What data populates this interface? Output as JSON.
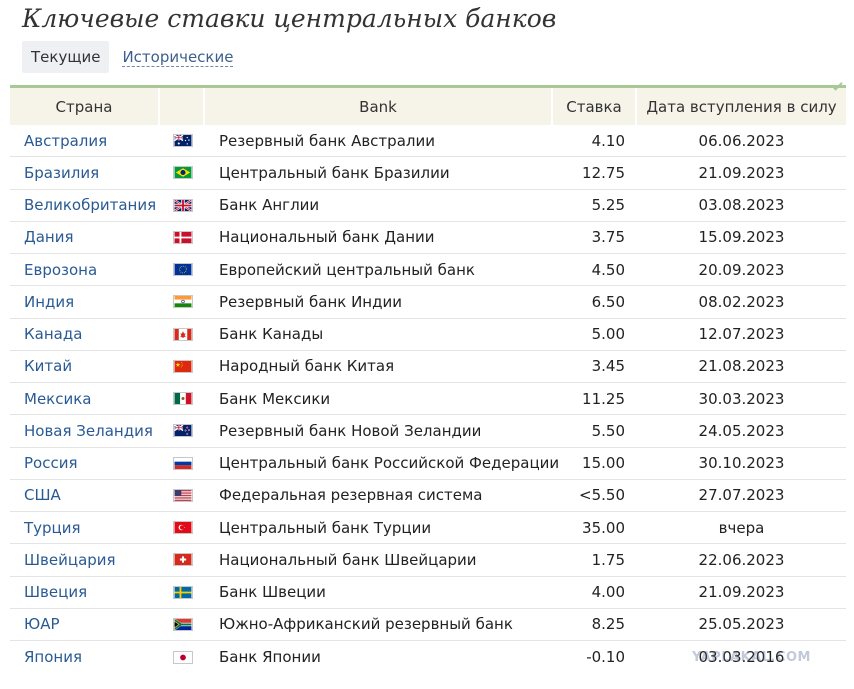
{
  "page": {
    "title": "Ключевые ставки центральных банков"
  },
  "tabs": [
    {
      "label": "Текущие",
      "active": true
    },
    {
      "label": "Исторические",
      "active": false
    }
  ],
  "table": {
    "headers": {
      "country": "Страна",
      "flag": "",
      "bank": "Bank",
      "rate": "Ставка",
      "date": "Дата вступления в силу"
    },
    "rows": [
      {
        "country": "Австралия",
        "flag": "australia-flag-icon",
        "bank": "Резервный банк Австралии",
        "rate": "4.10",
        "date": "06.06.2023"
      },
      {
        "country": "Бразилия",
        "flag": "brazil-flag-icon",
        "bank": "Центральный банк Бразилии",
        "rate": "12.75",
        "date": "21.09.2023"
      },
      {
        "country": "Великобритания",
        "flag": "uk-flag-icon",
        "bank": "Банк Англии",
        "rate": "5.25",
        "date": "03.08.2023"
      },
      {
        "country": "Дания",
        "flag": "denmark-flag-icon",
        "bank": "Национальный банк Дании",
        "rate": "3.75",
        "date": "15.09.2023"
      },
      {
        "country": "Еврозона",
        "flag": "eu-flag-icon",
        "bank": "Европейский центральный банк",
        "rate": "4.50",
        "date": "20.09.2023"
      },
      {
        "country": "Индия",
        "flag": "india-flag-icon",
        "bank": "Резервный банк Индии",
        "rate": "6.50",
        "date": "08.02.2023"
      },
      {
        "country": "Канада",
        "flag": "canada-flag-icon",
        "bank": "Банк Канады",
        "rate": "5.00",
        "date": "12.07.2023"
      },
      {
        "country": "Китай",
        "flag": "china-flag-icon",
        "bank": "Народный банк Китая",
        "rate": "3.45",
        "date": "21.08.2023"
      },
      {
        "country": "Мексика",
        "flag": "mexico-flag-icon",
        "bank": "Банк Мексики",
        "rate": "11.25",
        "date": "30.03.2023"
      },
      {
        "country": "Новая Зеландия",
        "flag": "new-zealand-flag-icon",
        "bank": "Резервный банк Новой Зеландии",
        "rate": "5.50",
        "date": "24.05.2023"
      },
      {
        "country": "Россия",
        "flag": "russia-flag-icon",
        "bank": "Центральный банк Российской Федерации",
        "rate": "15.00",
        "date": "30.10.2023"
      },
      {
        "country": "США",
        "flag": "usa-flag-icon",
        "bank": "Федеральная резервная система",
        "rate": "<5.50",
        "date": "27.07.2023"
      },
      {
        "country": "Турция",
        "flag": "turkey-flag-icon",
        "bank": "Центральный банк Турции",
        "rate": "35.00",
        "date": "вчера"
      },
      {
        "country": "Швейцария",
        "flag": "switzerland-flag-icon",
        "bank": "Национальный банк Швейцарии",
        "rate": "1.75",
        "date": "22.06.2023"
      },
      {
        "country": "Швеция",
        "flag": "sweden-flag-icon",
        "bank": "Банк Швеции",
        "rate": "4.00",
        "date": "21.09.2023"
      },
      {
        "country": "ЮАР",
        "flag": "south-africa-flag-icon",
        "bank": "Южно-Африканский резервный банк",
        "rate": "8.25",
        "date": "25.05.2023"
      },
      {
        "country": "Япония",
        "flag": "japan-flag-icon",
        "bank": "Банк Японии",
        "rate": "-0.10",
        "date": "03.03.2016"
      }
    ]
  },
  "watermark": "YAPLAKAL.COM",
  "colors": {
    "accent": "#a8c895",
    "link": "#2a5a93",
    "header_bg": "#f6f4e9",
    "tab_active_bg": "#eef0f4"
  }
}
